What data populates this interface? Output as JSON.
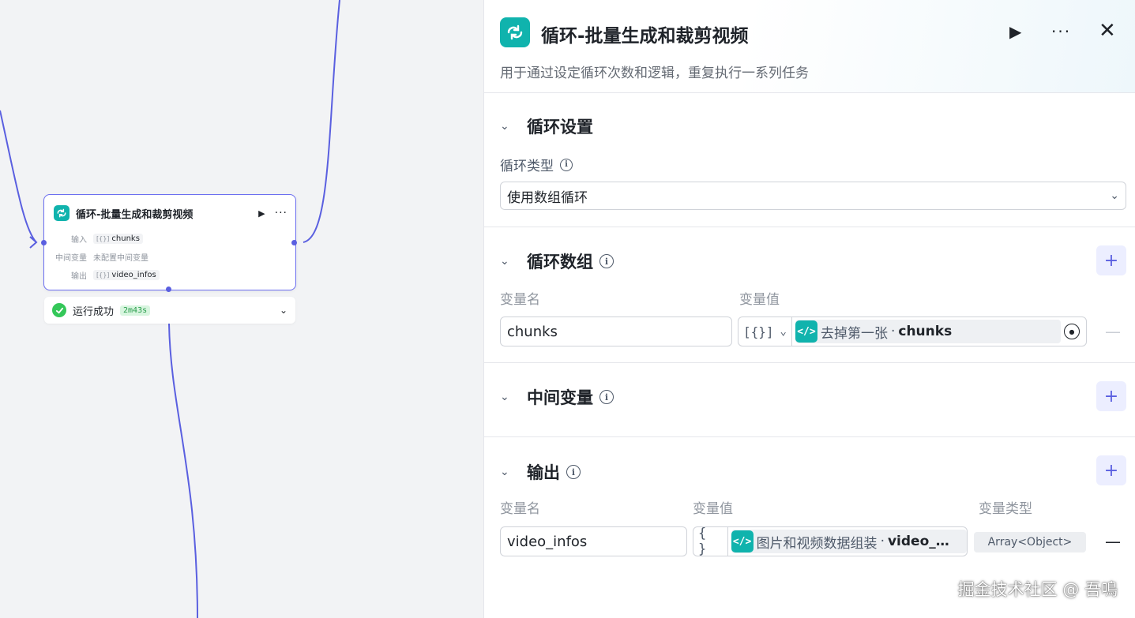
{
  "node": {
    "title": "循环-批量生成和裁剪视频",
    "run_icon": "play-icon",
    "more_icon": "more-icon",
    "input_label": "输入",
    "input_tag_icon": "[{}]",
    "input_value": "chunks",
    "mid_label": "中间变量",
    "mid_value": "未配置中间变量",
    "output_label": "输出",
    "output_tag_icon": "[{}]",
    "output_value": "video_infos"
  },
  "status": {
    "text": "运行成功",
    "duration": "2m43s"
  },
  "panel": {
    "title": "循环-批量生成和裁剪视频",
    "description": "用于通过设定循环次数和逻辑，重复执行一系列任务",
    "loop_settings": {
      "title": "循环设置",
      "type_label": "循环类型",
      "type_value": "使用数组循环"
    },
    "loop_array": {
      "title": "循环数组",
      "col_name": "变量名",
      "col_value": "变量值",
      "row": {
        "name": "chunks",
        "type_glyph": "[{}]",
        "source": "去掉第一张",
        "sep": "·",
        "variable": "chunks"
      }
    },
    "mid_vars": {
      "title": "中间变量"
    },
    "outputs": {
      "title": "输出",
      "col_name": "变量名",
      "col_value": "变量值",
      "col_type": "变量类型",
      "row": {
        "name": "video_infos",
        "type_glyph": "{ }",
        "source": "图片和视频数据组装",
        "sep": "·",
        "variable": "video_…",
        "var_type": "Array<Object>"
      }
    }
  },
  "watermark": "掘金技术社区 @ 吾鳴",
  "colors": {
    "accent": "#5a5fe0",
    "teal": "#10b3ad",
    "success": "#34c759"
  }
}
